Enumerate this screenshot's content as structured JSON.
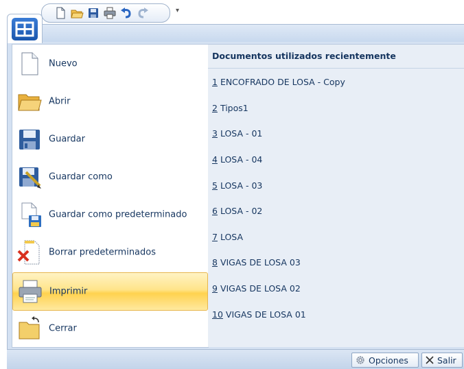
{
  "app": {
    "icon": "app-menu-icon"
  },
  "quick_access": {
    "buttons": [
      {
        "icon": "new-document-icon"
      },
      {
        "icon": "open-folder-icon"
      },
      {
        "icon": "save-disk-icon"
      },
      {
        "icon": "print-icon"
      },
      {
        "icon": "undo-icon"
      },
      {
        "icon": "redo-icon"
      }
    ],
    "customize": "▾"
  },
  "menu": {
    "commands": [
      {
        "label": "Nuevo",
        "icon": "new-document-icon"
      },
      {
        "label": "Abrir",
        "icon": "open-folder-icon"
      },
      {
        "label": "Guardar",
        "icon": "save-disk-icon"
      },
      {
        "label": "Guardar como",
        "icon": "save-as-icon"
      },
      {
        "label": "Guardar como predeterminado",
        "icon": "save-as-default-icon"
      },
      {
        "label": "Borrar predeterminados",
        "icon": "delete-defaults-icon"
      },
      {
        "label": "Imprimir",
        "icon": "printer-icon",
        "highlighted": true
      },
      {
        "label": "Cerrar",
        "icon": "close-folder-icon"
      }
    ]
  },
  "recent": {
    "title": "Documentos utilizados recientemente",
    "items": [
      {
        "num": "1",
        "name": "ENCOFRADO DE LOSA - Copy"
      },
      {
        "num": "2",
        "name": "Tipos1"
      },
      {
        "num": "3",
        "name": "LOSA - 01"
      },
      {
        "num": "4",
        "name": "LOSA - 04"
      },
      {
        "num": "5",
        "name": "LOSA - 03"
      },
      {
        "num": "6",
        "name": "LOSA - 02"
      },
      {
        "num": "7",
        "name": "LOSA"
      },
      {
        "num": "8",
        "name": "VIGAS DE LOSA 03"
      },
      {
        "num": "9",
        "name": "VIGAS DE LOSA 02"
      },
      {
        "num": "10",
        "name": "VIGAS DE LOSA 01"
      }
    ]
  },
  "footer": {
    "options_label": "Opciones",
    "exit_label": "Salir"
  },
  "colors": {
    "accent_blue": "#1a56ad",
    "highlight": "#ffd24f",
    "text": "#15355f"
  }
}
